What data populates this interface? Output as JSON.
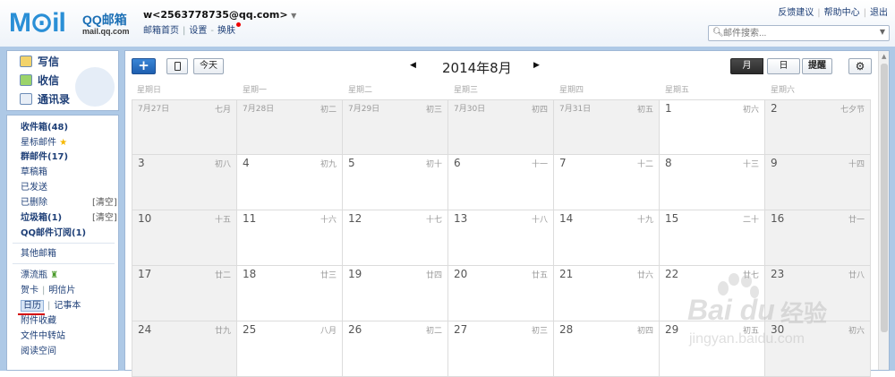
{
  "header": {
    "logo_mail": "M⊙il",
    "logo_qq": "QQ邮箱",
    "logo_url": "mail.qq.com",
    "account": "w<2563778735@qq.com>",
    "links": [
      "邮箱首页",
      "设置",
      "换肤"
    ],
    "toplinks": [
      "反馈建议",
      "帮助中心",
      "退出"
    ],
    "search_placeholder": "邮件搜索..."
  },
  "compose": {
    "write": "写信",
    "receive": "收信",
    "contacts": "通讯录"
  },
  "folders": {
    "inbox": "收件箱(48)",
    "starred": "星标邮件",
    "group": "群邮件(17)",
    "drafts": "草稿箱",
    "sent": "已发送",
    "deleted": "已删除",
    "clear": "[清空]",
    "junk": "垃圾箱(1)",
    "subscribe": "QQ邮件订阅(1)",
    "other": "其他邮箱",
    "bottle": "漂流瓶",
    "card": "贺卡",
    "postcard": "明信片",
    "calendar": "日历",
    "notes": "记事本",
    "attach": "附件收藏",
    "transfer": "文件中转站",
    "reading": "阅读空间"
  },
  "toolbar": {
    "add": "+",
    "today": "今天",
    "prev": "◀",
    "month_title": "2014年8月",
    "next": "▶",
    "view_month": "月",
    "view_day": "日",
    "view_remind": "提醒",
    "gear": "⚙"
  },
  "calendar": {
    "weekdays": [
      "星期日",
      "星期一",
      "星期二",
      "星期三",
      "星期四",
      "星期五",
      "星期六"
    ],
    "weeks": [
      [
        [
          "7月27日",
          "七月"
        ],
        [
          "7月28日",
          "初二"
        ],
        [
          "7月29日",
          "初三"
        ],
        [
          "7月30日",
          "初四"
        ],
        [
          "7月31日",
          "初五"
        ],
        [
          "1",
          "初六"
        ],
        [
          "2",
          "七夕节"
        ]
      ],
      [
        [
          "3",
          "初八"
        ],
        [
          "4",
          "初九"
        ],
        [
          "5",
          "初十"
        ],
        [
          "6",
          "十一"
        ],
        [
          "7",
          "十二"
        ],
        [
          "8",
          "十三"
        ],
        [
          "9",
          "十四"
        ]
      ],
      [
        [
          "10",
          "十五"
        ],
        [
          "11",
          "十六"
        ],
        [
          "12",
          "十七"
        ],
        [
          "13",
          "十八"
        ],
        [
          "14",
          "十九"
        ],
        [
          "15",
          "二十"
        ],
        [
          "16",
          "廿一"
        ]
      ],
      [
        [
          "17",
          "廿二"
        ],
        [
          "18",
          "廿三"
        ],
        [
          "19",
          "廿四"
        ],
        [
          "20",
          "廿五"
        ],
        [
          "21",
          "廿六"
        ],
        [
          "22",
          "廿七"
        ],
        [
          "23",
          "廿八"
        ]
      ],
      [
        [
          "24",
          "廿九"
        ],
        [
          "25",
          "八月"
        ],
        [
          "26",
          "初二"
        ],
        [
          "27",
          "初三"
        ],
        [
          "28",
          "初四"
        ],
        [
          "29",
          "初五"
        ],
        [
          "30",
          "初六"
        ]
      ]
    ]
  },
  "watermark": {
    "brand": "Bai du",
    "text": "经验",
    "url": "jingyan.baidu.com"
  },
  "colors": {
    "accent": "#1e5fb0",
    "sidebar_bg": "#aec9e6",
    "link": "#1e3f77"
  }
}
